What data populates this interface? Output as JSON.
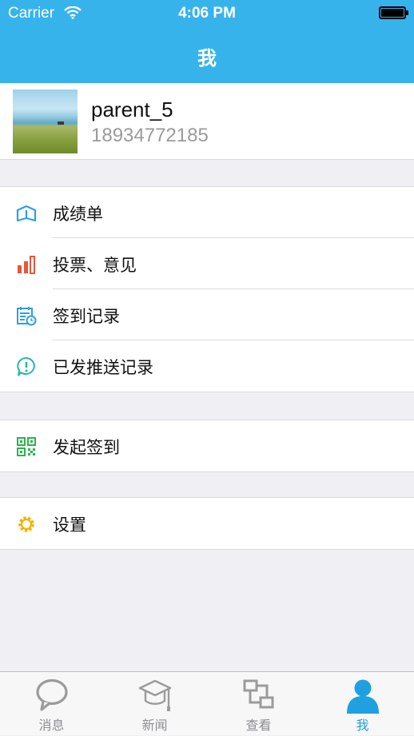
{
  "status_bar": {
    "carrier": "Carrier",
    "time": "4:06 PM"
  },
  "nav": {
    "title": "我"
  },
  "profile": {
    "name": "parent_5",
    "phone": "18934772185"
  },
  "menu": {
    "group1": [
      {
        "label": "成绩单",
        "icon": "book-icon",
        "color": "#2f9fe0"
      },
      {
        "label": "投票、意见",
        "icon": "bar-chart-icon",
        "color": "#e5563c"
      },
      {
        "label": "签到记录",
        "icon": "calendar-clock-icon",
        "color": "#2f9fe0"
      },
      {
        "label": "已发推送记录",
        "icon": "alert-bubble-icon",
        "color": "#25b7a8"
      }
    ],
    "group2": [
      {
        "label": "发起签到",
        "icon": "qr-code-icon",
        "color": "#2bb24c"
      }
    ],
    "group3": [
      {
        "label": "设置",
        "icon": "gear-icon",
        "color": "#f0b400"
      }
    ]
  },
  "tabbar": {
    "items": [
      {
        "label": "消息",
        "icon": "chat-bubble-icon"
      },
      {
        "label": "新闻",
        "icon": "graduation-cap-icon"
      },
      {
        "label": "查看",
        "icon": "window-connect-icon"
      },
      {
        "label": "我",
        "icon": "person-icon",
        "active": true
      }
    ]
  },
  "colors": {
    "accent": "#37b3ec",
    "tab_active": "#1fa0e0",
    "tab_inactive": "#8e8e93"
  }
}
